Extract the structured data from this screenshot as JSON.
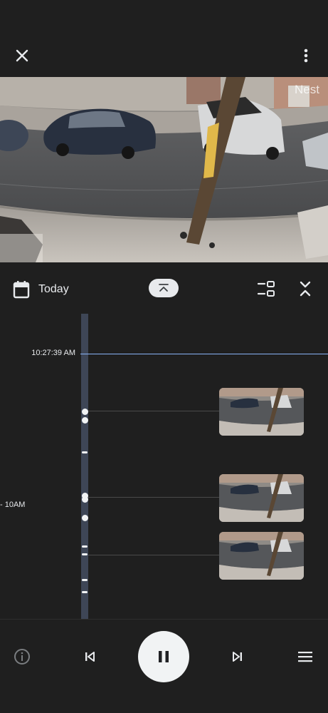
{
  "header": {
    "close_icon": "close-icon",
    "more_icon": "more-vertical-icon"
  },
  "feed": {
    "watermark": "Nest"
  },
  "controls": {
    "date_label": "Today",
    "calendar_icon": "calendar-icon",
    "collapse_icon": "chevron-up-icon",
    "layout_icon": "layout-toggle-icon",
    "compress_icon": "compress-icon"
  },
  "timeline": {
    "current_time": "10:27:39 AM",
    "hour_marker": "- 10AM",
    "events": [
      {
        "thumbnail": "camera-clip-thumbnail"
      },
      {
        "thumbnail": "camera-clip-thumbnail"
      },
      {
        "thumbnail": "camera-clip-thumbnail"
      }
    ]
  },
  "playback": {
    "info_icon": "info-icon",
    "prev_icon": "skip-previous-icon",
    "play_state": "pause",
    "next_icon": "skip-next-icon",
    "menu_icon": "menu-icon"
  },
  "colors": {
    "background": "#1f1f1f",
    "accent_line": "#8ab4f8",
    "rail": "#3e4656"
  }
}
